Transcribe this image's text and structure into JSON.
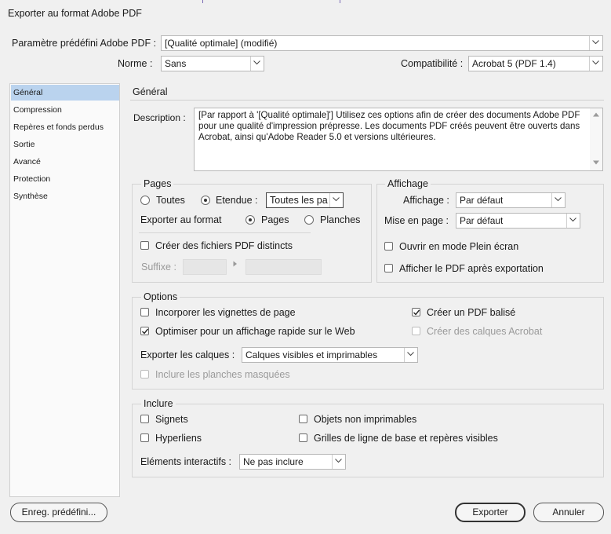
{
  "window": {
    "title": "Exporter au format Adobe PDF"
  },
  "preset": {
    "label": "Paramètre prédéfini Adobe PDF :",
    "value": "[Qualité optimale] (modifié)"
  },
  "norme": {
    "label": "Norme :",
    "value": "Sans"
  },
  "compat": {
    "label": "Compatibilité :",
    "value": "Acrobat 5 (PDF 1.4)"
  },
  "sidebar": {
    "items": [
      {
        "label": "Général",
        "selected": true
      },
      {
        "label": "Compression"
      },
      {
        "label": "Repères et fonds perdus"
      },
      {
        "label": "Sortie"
      },
      {
        "label": "Avancé"
      },
      {
        "label": "Protection"
      },
      {
        "label": "Synthèse"
      }
    ]
  },
  "general": {
    "heading": "Général",
    "description_label": "Description :",
    "description_text": "[Par rapport à '[Qualité optimale]'] Utilisez ces options afin de créer des documents Adobe PDF pour une qualité d'impression prépresse. Les documents PDF créés peuvent être ouverts dans Acrobat, ainsi qu'Adobe Reader 5.0 et versions ultérieures."
  },
  "pages": {
    "label": "Pages",
    "toutes": "Toutes",
    "etendue": "Etendue :",
    "etendue_value": "Toutes les pa",
    "export_format_label": "Exporter au format",
    "pages_opt": "Pages",
    "planches_opt": "Planches",
    "distinct_label": "Créer des fichiers PDF distincts",
    "suffixe_label": "Suffixe :"
  },
  "affichage": {
    "label": "Affichage",
    "affichage_label": "Affichage :",
    "affichage_value": "Par défaut",
    "mise_label": "Mise en page :",
    "mise_value": "Par défaut",
    "plein_ecran": "Ouvrir en mode Plein écran",
    "afficher_apres": "Afficher le PDF après exportation"
  },
  "options": {
    "label": "Options",
    "vignettes": "Incorporer les vignettes de page",
    "optimiser": "Optimiser pour un affichage rapide sur le Web",
    "balise": "Créer un PDF balisé",
    "calques_acrobat": "Créer des calques Acrobat",
    "export_calques_label": "Exporter les calques :",
    "export_calques_value": "Calques visibles et imprimables",
    "planches_masquees": "Inclure les planches masquées"
  },
  "inclure": {
    "label": "Inclure",
    "signets": "Signets",
    "hyperliens": "Hyperliens",
    "objets": "Objets non imprimables",
    "grilles": "Grilles de ligne de base et repères visibles",
    "interactifs_label": "Eléments interactifs :",
    "interactifs_value": "Ne pas inclure"
  },
  "buttons": {
    "save_preset": "Enreg. prédéfini...",
    "export": "Exporter",
    "cancel": "Annuler"
  }
}
